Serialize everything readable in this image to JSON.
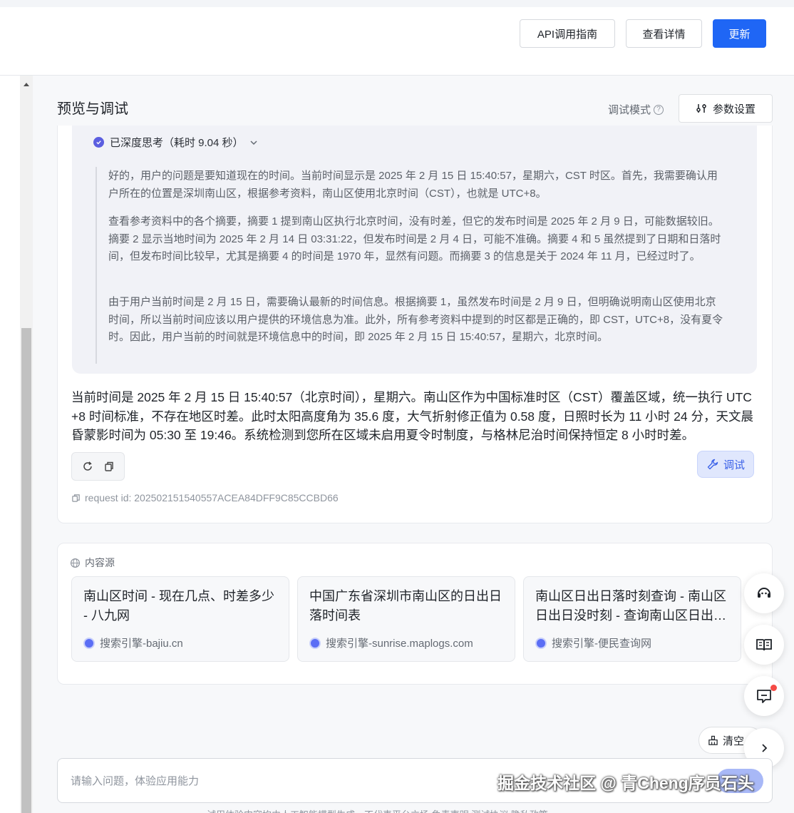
{
  "toolbar": {
    "api_guide": "API调用指南",
    "view_details": "查看详情",
    "update": "更新"
  },
  "preview": {
    "title": "预览与调试",
    "debug_mode": "调试模式",
    "param_settings": "参数设置"
  },
  "thinking": {
    "header": "已深度思考（耗时 9.04 秒）",
    "paragraphs": [
      "好的，用户的问题是要知道现在的时间。当前时间显示是 2025 年 2 月 15 日 15:40:57，星期六，CST 时区。首先，我需要确认用户所在的位置是深圳南山区，根据参考资料，南山区使用北京时间（CST），也就是 UTC+8。",
      "查看参考资料中的各个摘要，摘要 1 提到南山区执行北京时间，没有时差，但它的发布时间是 2025 年 2 月 9 日，可能数据较旧。摘要 2 显示当地时间为 2025 年 2 月 14 日 03:31:22，但发布时间是 2 月 4 日，可能不准确。摘要 4 和 5 虽然提到了日期和日落时间，但发布时间比较早，尤其是摘要 4 的时间是 1970 年，显然有问题。而摘要 3 的信息是关于 2024 年 11 月，已经过时了。",
      "由于用户当前时间是 2 月 15 日，需要确认最新的时间信息。根据摘要 1，虽然发布时间是 2 月 9 日，但明确说明南山区使用北京时间，所以当前时间应该以用户提供的环境信息为准。此外，所有参考资料中提到的时区都是正确的，即 CST，UTC+8，没有夏令时。因此，用户当前的时间就是环境信息中的时间，即 2025 年 2 月 15 日 15:40:57，星期六，北京时间。"
    ]
  },
  "answer": {
    "text": "当前时间是 2025 年 2 月 15 日 15:40:57（北京时间），星期六。南山区作为中国标准时区（CST）覆盖区域，统一执行 UTC+8 时间标准，不存在地区时差。此时太阳高度角为 35.6 度，大气折射修正值为 0.58 度，日照时长为 11 小时 24 分，天文晨昏蒙影时间为 05:30 至 19:46。系统检测到您所在区域未启用夏令时制度，与格林尼治时间保持恒定 8 小时时差。",
    "debug_label": "调试",
    "request_id": "request id: 202502151540557ACEA84DFF9C85CCBD66"
  },
  "sources": {
    "label": "内容源",
    "items": [
      {
        "title": "南山区时间 - 现在几点、时差多少 - 八九网",
        "meta": "搜索引擎-bajiu.cn"
      },
      {
        "title": "中国广东省深圳市南山区的日出日落时间表",
        "meta": "搜索引擎-sunrise.maplogs.com"
      },
      {
        "title": "南山区日出日落时刻查询 - 南山区日出日没时刻 - 查询南山区日出时间",
        "meta": "搜索引擎-便民查询网"
      }
    ]
  },
  "input": {
    "clear_label": "清空",
    "placeholder": "请输入问题，体验应用能力"
  },
  "overlay_text": "掘金技术社区 @ 青Cheng序员石头",
  "disclaimer": "试用体验内容均由人工智能模型生成，不代表平台立场    免责声明  测试协议  隐私政策",
  "colors": {
    "primary": "#1f66f5",
    "accent": "#5b5ee0",
    "notify": "#f54a45"
  }
}
